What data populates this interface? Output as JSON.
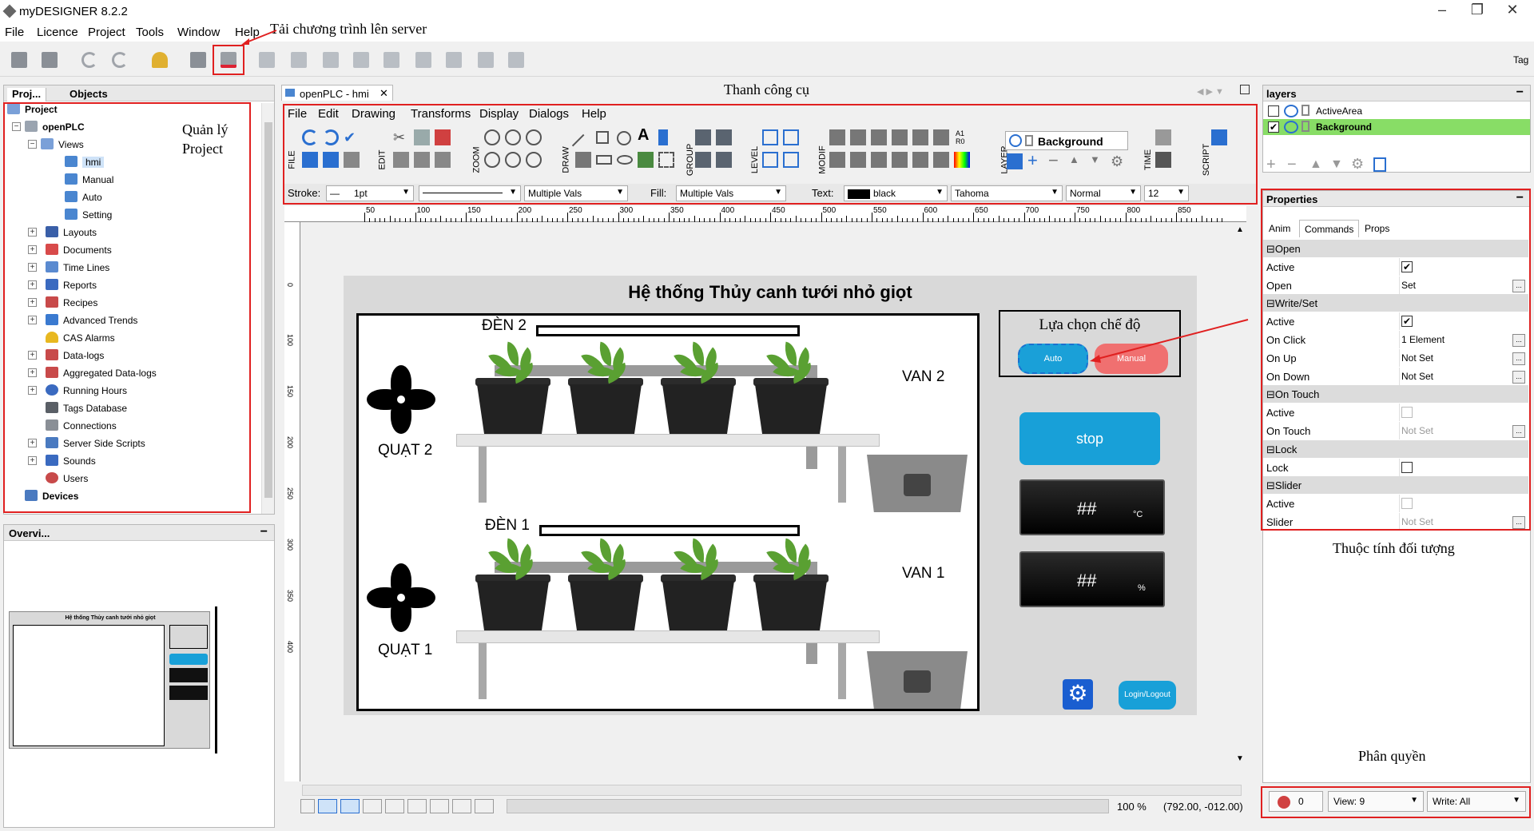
{
  "window": {
    "title": "myDESIGNER 8.2.2",
    "controls": [
      "–",
      "❐",
      "✕"
    ]
  },
  "menu": [
    "File",
    "Licence",
    "Project",
    "Tools",
    "Window",
    "Help"
  ],
  "annotations": {
    "upload": "Tải chương trình lên server",
    "toolbar": "Thanh công cụ",
    "project_mgmt_1": "Quản lý",
    "project_mgmt_2": "Project",
    "properties": "Thuộc tính  đối tượng",
    "permissions": "Phân  quyền"
  },
  "right_tag": "Tag",
  "project_panel": {
    "tabs": [
      "Proj...",
      "Objects"
    ],
    "root": "Project",
    "project": "openPLC",
    "views_label": "Views",
    "views": [
      "hmi",
      "Manual",
      "Auto",
      "Setting"
    ],
    "items": [
      "Layouts",
      "Documents",
      "Time Lines",
      "Reports",
      "Recipes",
      "Advanced Trends",
      "CAS Alarms",
      "Data-logs",
      "Aggregated Data-logs",
      "Running Hours",
      "Tags Database",
      "Connections",
      "Server Side Scripts",
      "Sounds",
      "Users"
    ],
    "devices": "Devices"
  },
  "overview": {
    "title": "Overvi...",
    "thumb_title": "Hệ thống Thủy canh tưới nhỏ giọt"
  },
  "editor": {
    "tab": "openPLC - hmi",
    "menu": [
      "File",
      "Edit",
      "Drawing",
      "Transforms",
      "Display",
      "Dialogs",
      "Help"
    ],
    "groups": [
      "FILE",
      "EDIT",
      "ZOOM",
      "DRAW",
      "GROUP",
      "LEVEL",
      "MODIF",
      "LAYER",
      "TIME",
      "SCRIPT"
    ],
    "layer_value": "Background",
    "a1r0": [
      "A1",
      "R0"
    ],
    "stroke_label": "Stroke:",
    "stroke_value": "1pt",
    "stroke_multi": "Multiple Vals",
    "fill_label": "Fill:",
    "fill_value": "Multiple Vals",
    "text_label": "Text:",
    "text_color": "black",
    "font": "Tahoma",
    "style": "Normal",
    "size": "12",
    "ruler_ticks": [
      "50",
      "100",
      "150",
      "200",
      "250",
      "300",
      "350",
      "400",
      "450",
      "500",
      "550",
      "600",
      "650",
      "700",
      "750",
      "800",
      "850"
    ],
    "vruler_ticks": [
      "0",
      "100",
      "150",
      "200",
      "250",
      "300",
      "350",
      "400"
    ],
    "zoom": "100 %",
    "coords": "(792.00, -012.00)"
  },
  "hmi": {
    "title": "Hệ thống Thủy canh tưới nhỏ giọt",
    "light2": "ĐÈN 2",
    "light1": "ĐÈN 1",
    "valve2": "VAN 2",
    "valve1": "VAN 1",
    "fan2": "QUẠT 2",
    "fan1": "QUẠT 1",
    "mode_title": "Lựa chọn chế độ",
    "auto": "Auto",
    "manual": "Manual",
    "stop": "stop",
    "temp_value": "##",
    "temp_unit": "°C",
    "hum_value": "##",
    "hum_unit": "%",
    "login": "Login/Logout"
  },
  "layers": {
    "title": "layers",
    "items": [
      {
        "name": "ActiveArea",
        "checked": false
      },
      {
        "name": "Background",
        "checked": true
      }
    ]
  },
  "properties": {
    "title": "Properties",
    "tabs": [
      "Anim",
      "Commands",
      "Props"
    ],
    "rows": [
      {
        "type": "group",
        "label": "Open"
      },
      {
        "type": "check",
        "label": "Active",
        "checked": true
      },
      {
        "type": "value",
        "label": "Open",
        "value": "Set",
        "dots": true
      },
      {
        "type": "group",
        "label": "Write/Set"
      },
      {
        "type": "check",
        "label": "Active",
        "checked": true
      },
      {
        "type": "value",
        "label": "On Click",
        "value": "1 Element",
        "dots": true
      },
      {
        "type": "value",
        "label": "On Up",
        "value": "Not Set",
        "dots": true
      },
      {
        "type": "value",
        "label": "On Down",
        "value": "Not Set",
        "dots": true
      },
      {
        "type": "group",
        "label": "On Touch"
      },
      {
        "type": "check",
        "label": "Active",
        "checked": false,
        "disabled": true
      },
      {
        "type": "value",
        "label": "On Touch",
        "value": "Not Set",
        "dots": true,
        "disabled": true
      },
      {
        "type": "group",
        "label": "Lock"
      },
      {
        "type": "check",
        "label": "Lock",
        "checked": false
      },
      {
        "type": "group",
        "label": "Slider"
      },
      {
        "type": "check",
        "label": "Active",
        "checked": false,
        "disabled": true
      },
      {
        "type": "value",
        "label": "Slider",
        "value": "Not Set",
        "dots": true,
        "disabled": true
      }
    ]
  },
  "permissions": {
    "count": "0",
    "view": "View: 9",
    "write": "Write: All"
  }
}
